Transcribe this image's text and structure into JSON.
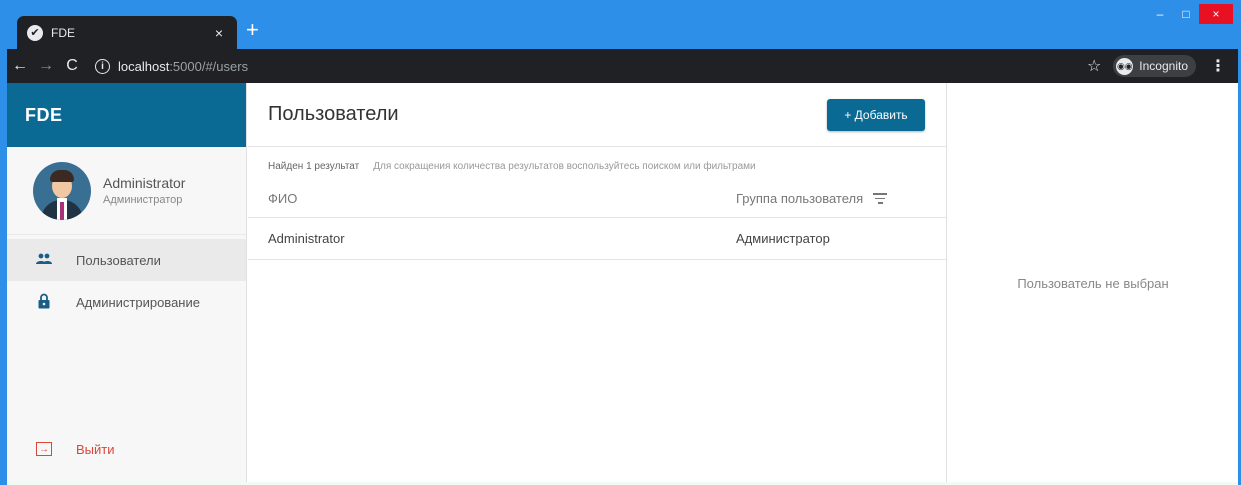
{
  "browser": {
    "tab_title": "FDE",
    "tab_favicon": "✔",
    "tab_close": "×",
    "new_tab": "+",
    "url_host": "localhost",
    "url_path": ":5000/#/users",
    "incognito_label": "Incognito",
    "window_controls": {
      "minimize": "–",
      "maximize": "□",
      "close": "×"
    },
    "accent_color": "#2e8fe8"
  },
  "sidebar": {
    "brand": "FDE",
    "brand_color": "#0a6a94",
    "user": {
      "name": "Administrator",
      "role": "Администратор"
    },
    "items": [
      {
        "label": "Пользователи",
        "icon": "people-icon",
        "active": true
      },
      {
        "label": "Администрирование",
        "icon": "lock-icon",
        "active": false
      }
    ],
    "logout": {
      "label": "Выйти",
      "icon": "logout-icon",
      "color": "#d9473a"
    }
  },
  "main": {
    "title": "Пользователи",
    "add_button": "+ Добавить",
    "results_count": "Найден 1 результат",
    "results_hint": "Для сокращения количества результатов воспользуйтесь поиском или фильтрами",
    "columns": {
      "name": "ФИО",
      "group": "Группа пользователя"
    },
    "rows": [
      {
        "name": "Administrator",
        "group": "Администратор"
      }
    ]
  },
  "detail": {
    "empty_message": "Пользователь не выбран"
  }
}
